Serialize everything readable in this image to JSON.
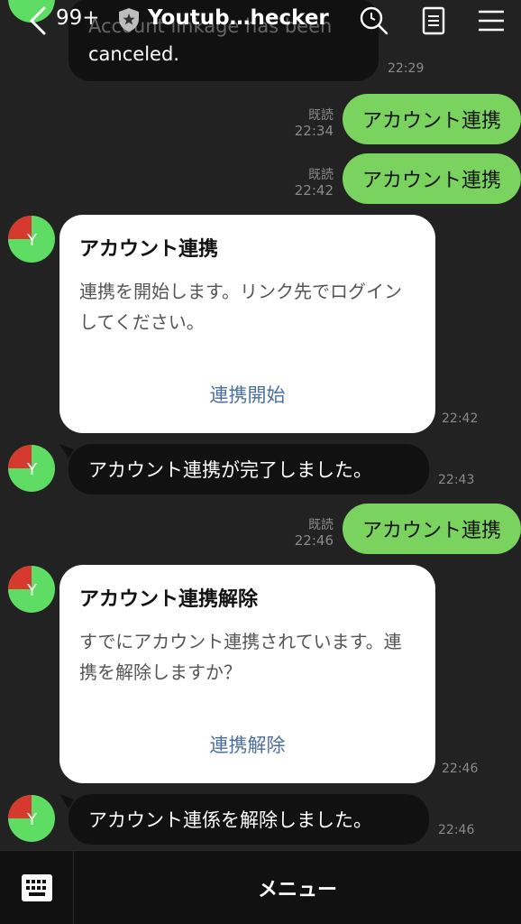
{
  "header": {
    "back_count": "99+",
    "title": "Youtub…hecker"
  },
  "messages": {
    "m0": {
      "text_line1": "Account linkage has been",
      "text_line2": "canceled.",
      "time": "22:29"
    },
    "m1": {
      "text": "アカウント連携",
      "read": "既読",
      "time": "22:34"
    },
    "m2": {
      "text": "アカウント連携",
      "read": "既読",
      "time": "22:42"
    },
    "m3": {
      "title": "アカウント連携",
      "body": "連携を開始します。リンク先でログインしてください。",
      "action": "連携開始",
      "time": "22:42"
    },
    "m4": {
      "text": "アカウント連携が完了しました。",
      "time": "22:43"
    },
    "m5": {
      "text": "アカウント連携",
      "read": "既読",
      "time": "22:46"
    },
    "m6": {
      "title": "アカウント連携解除",
      "body": "すでにアカウント連携されています。連携を解除しますか？",
      "action": "連携解除",
      "time": "22:46"
    },
    "m7": {
      "text": "アカウント連係を解除しました。",
      "time": "22:46"
    }
  },
  "bottom": {
    "menu_label": "メニュー"
  },
  "icons": {
    "back": "chevron-left-icon",
    "shield": "shield-star-icon",
    "search": "search-icon",
    "notes": "notes-icon",
    "menu": "hamburger-menu-icon",
    "keyboard": "keyboard-icon"
  },
  "colors": {
    "background": "#222222",
    "bubble_dark": "#111111",
    "bubble_green": "#7bd35f",
    "card": "#ffffff",
    "link": "#4a6fa0"
  }
}
